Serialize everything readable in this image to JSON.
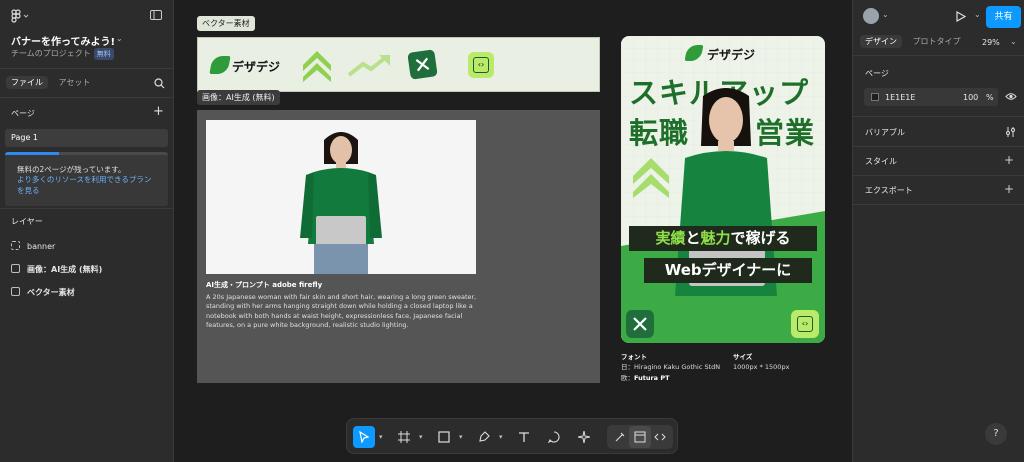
{
  "left_panel": {
    "project_title": "バナーを作ってみよう!",
    "team_project": "チームのプロジェクト",
    "free_badge": "無料",
    "tabs": [
      "ファイル",
      "アセット"
    ],
    "pages_label": "ページ",
    "page_item": "Page 1",
    "free_notice_line1": "無料の2ページが残っています。",
    "free_notice_link": "より多くのリソースを利用できるプランを見る",
    "free_progress": 0.33,
    "layers_label": "レイヤー",
    "layers": [
      "banner",
      "画像：AI生成 (無料)",
      "ベクター素材"
    ]
  },
  "right_panel": {
    "share_label": "共有",
    "tabs": [
      "デザイン",
      "プロトタイプ"
    ],
    "zoom": "29%",
    "page_section": "ページ",
    "bg_hex": "1E1E1E",
    "bg_opacity": "100",
    "bg_unit": "%",
    "sections": [
      "バリアブル",
      "スタイル",
      "エクスポート"
    ]
  },
  "canvas": {
    "vector_tag": "ベクター素材",
    "image_tag": "画像：AI生成 (無料)",
    "banner_logo": "デザデジ",
    "caption_title": "AI生成・プロンプト adobe firefly",
    "caption_body": "A 20s Japanese woman with fair skin and short hair, wearing a long green sweater, standing with her arms hanging straight down while holding a closed laptop like a notebook with both hands at waist height, expressionless face, Japanese facial features, on a pure white background, realistic studio lighting.",
    "poster": {
      "logo": "デザデジ",
      "line1": "スキルアップ",
      "line2a": "転職",
      "line2b": "営業",
      "band1_a": "実績",
      "band1_b": "と",
      "band1_c": "魅力",
      "band1_d": "で稼げる",
      "band2": "Webデザイナーに"
    },
    "font_label": "フォント",
    "font_jp": "日：Hiragino Kaku Gothic StdN",
    "font_en_prefix": "欧：",
    "font_en": "Futura PT",
    "size_label": "サイズ",
    "size_value": "1000px * 1500px"
  },
  "toolbar": {
    "tools": [
      "move-tool",
      "frame-tool",
      "shape-tool",
      "pen-tool",
      "text-tool",
      "comment-tool",
      "actions-tool"
    ]
  },
  "help_label": "?",
  "colors": {
    "accent": "#0d99ff",
    "green": "#2f9b3a",
    "panel": "#2c2c2c",
    "canvas": "#1e1e1e"
  }
}
